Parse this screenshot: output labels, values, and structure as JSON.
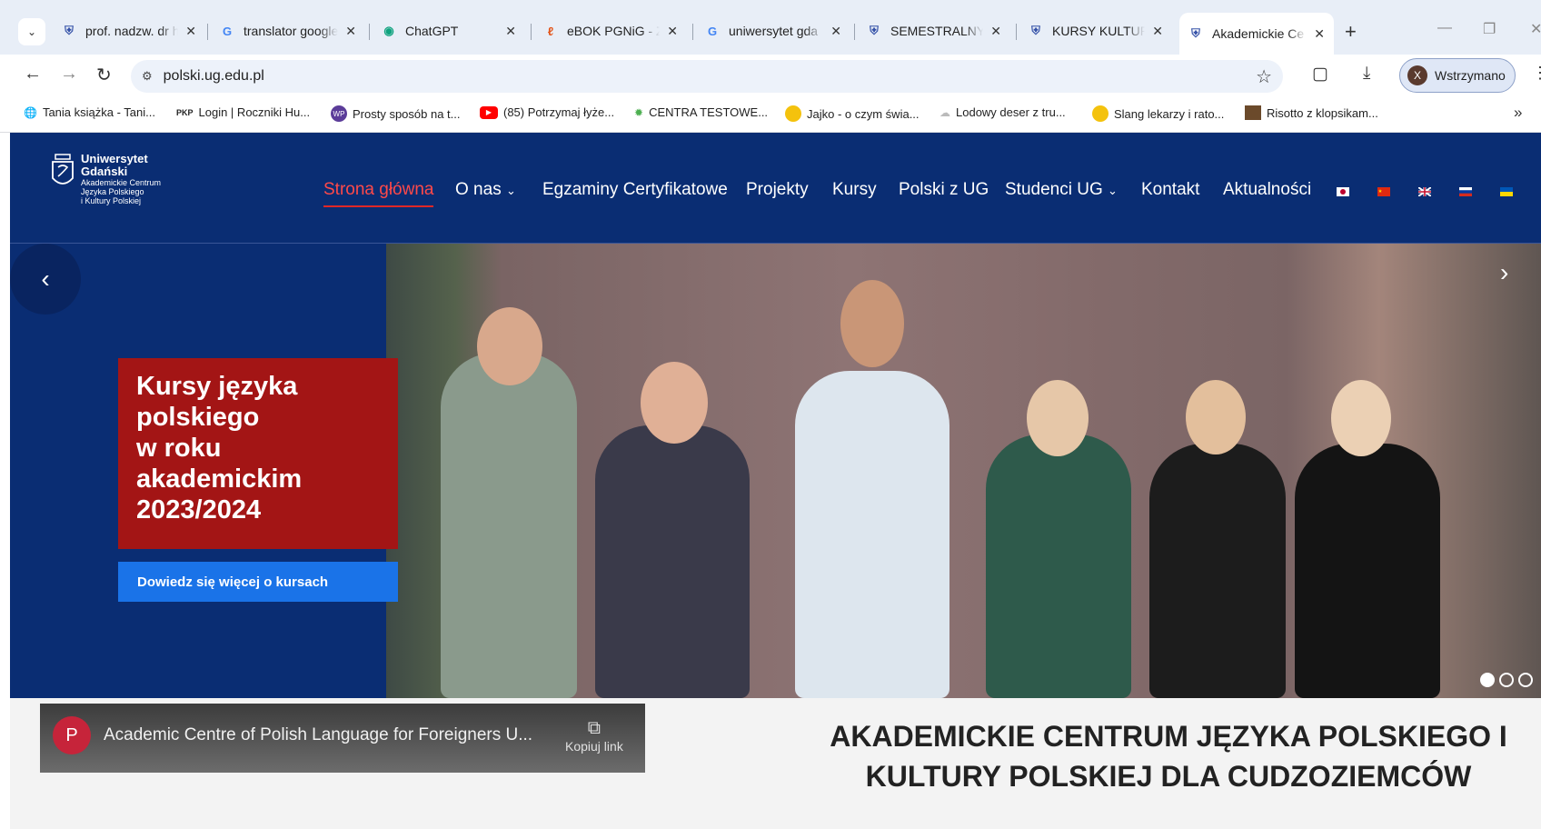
{
  "browser": {
    "tabs": [
      {
        "title": "prof. nadzw. dr h",
        "favicon": "ug-shield-icon"
      },
      {
        "title": "translator google",
        "favicon": "google-g-icon"
      },
      {
        "title": "ChatGPT",
        "favicon": "chatgpt-icon"
      },
      {
        "title": "eBOK PGNiG - Z",
        "favicon": "flame-icon"
      },
      {
        "title": "uniwersytet gda",
        "favicon": "google-g-icon"
      },
      {
        "title": "SEMESTRALNY K",
        "favicon": "ug-shield-icon"
      },
      {
        "title": "KURSY KULTURY",
        "favicon": "ug-shield-icon"
      },
      {
        "title": "Akademickie Ce",
        "favicon": "ug-shield-icon",
        "active": true
      }
    ],
    "new_tab": "+",
    "url": "polski.ug.edu.pl",
    "profile": {
      "initial": "X",
      "label": "Wstrzymano"
    },
    "bookmarks": [
      {
        "label": "Tania książka - Tani...",
        "icon": "globe-icon"
      },
      {
        "label": "Login | Roczniki Hu...",
        "icon": "pkp-icon",
        "prefix": "PKP"
      },
      {
        "label": "Prosty sposób na t...",
        "icon": "wp-icon",
        "prefix": "WP"
      },
      {
        "label": "(85) Potrzymaj łyże...",
        "icon": "youtube-icon"
      },
      {
        "label": "CENTRA TESTOWE...",
        "icon": "star-green-icon"
      },
      {
        "label": "Jajko - o czym świa...",
        "icon": "yellow-dot-icon"
      },
      {
        "label": "Lodowy deser z tru...",
        "icon": "icecream-icon"
      },
      {
        "label": "Slang lekarzy i rato...",
        "icon": "yellow-dot-icon"
      },
      {
        "label": "Risotto z klopsikam...",
        "icon": "food-icon"
      }
    ]
  },
  "site": {
    "logo": {
      "line1": "Uniwersytet",
      "line2": "Gdański",
      "sub1": "Akademickie Centrum",
      "sub2": "Języka Polskiego",
      "sub3": "i Kultury Polskiej"
    },
    "nav": [
      {
        "label": "Strona główna",
        "active": true
      },
      {
        "label": "O nas",
        "dropdown": true
      },
      {
        "label": "Egzaminy Certyfikatowe"
      },
      {
        "label": "Projekty"
      },
      {
        "label": "Kursy"
      },
      {
        "label": "Polski z UG"
      },
      {
        "label": "Studenci UG",
        "dropdown": true
      },
      {
        "label": "Kontakt"
      },
      {
        "label": "Aktualności"
      }
    ],
    "flags": [
      "japan-flag-icon",
      "china-flag-icon",
      "uk-flag-icon",
      "russia-flag-icon",
      "ukraine-flag-icon"
    ],
    "hero": {
      "promo_lines": [
        "Kursy języka",
        "polskiego",
        "w roku",
        "akademickim",
        "2023/2024"
      ],
      "button": "Dowiedz się więcej o kursach",
      "slides_total": 3,
      "slide_active": 1
    },
    "video": {
      "avatar": "P",
      "title": "Academic Centre of Polish Language for Foreigners U...",
      "copy_label": "Kopiuj link"
    },
    "headline": "AKADEMICKIE CENTRUM JĘZYKA POLSKIEGO I KULTURY POLSKIEJ DLA CUDZOZIEMCÓW"
  },
  "colors": {
    "header_bg": "#0a2d73",
    "promo_bg": "#a31515",
    "button_bg": "#1a73e8",
    "nav_active": "#ff4949"
  }
}
